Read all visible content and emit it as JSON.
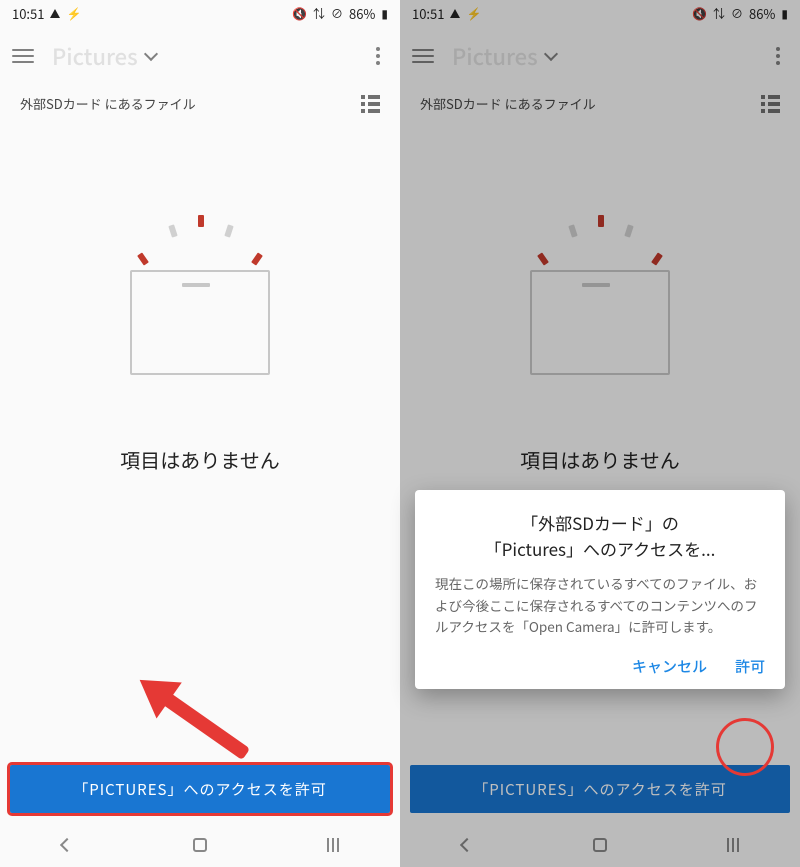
{
  "status": {
    "time": "10:51",
    "battery": "86%"
  },
  "appbar": {
    "title": "Pictures"
  },
  "subheader": {
    "path": "外部SDカード にあるファイル"
  },
  "empty": {
    "message": "項目はありません"
  },
  "button": {
    "label": "「PICTURES」へのアクセスを許可"
  },
  "dialog": {
    "title_line1": "「外部SDカード」の",
    "title_line2": "「Pictures」へのアクセスを...",
    "body": "現在この場所に保存されているすべてのファイル、および今後ここに保存されるすべてのコンテンツへのフルアクセスを「Open Camera」に許可します。",
    "cancel": "キャンセル",
    "allow": "許可"
  }
}
